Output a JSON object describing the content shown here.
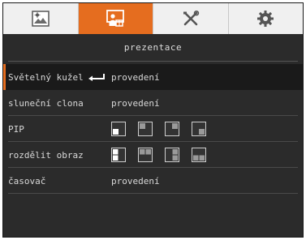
{
  "tabs": [
    {
      "name": "picture",
      "icon": "image-icon",
      "active": false
    },
    {
      "name": "presentation",
      "icon": "presenter-icon",
      "active": true
    },
    {
      "name": "tools",
      "icon": "tools-icon",
      "active": false
    },
    {
      "name": "settings",
      "icon": "gear-icon",
      "active": false
    }
  ],
  "colors": {
    "accent": "#e56d1f",
    "panel": "#2b2b2b",
    "text": "#d8d8d8"
  },
  "title": "prezentace",
  "rows": [
    {
      "label": "Světelný kužel",
      "value": "provedení",
      "selected": true,
      "icon": "enter-icon"
    },
    {
      "label": "sluneční clona",
      "value": "provedení"
    },
    {
      "label": "PIP",
      "options": [
        "pip-bottom-left-icon",
        "pip-top-left-icon",
        "pip-top-right-icon",
        "pip-bottom-right-icon"
      ]
    },
    {
      "label": "rozdělit obraz",
      "options": [
        "split-left-icon",
        "split-top-icon",
        "split-right-icon",
        "split-bottom-icon"
      ]
    },
    {
      "label": "časovač",
      "value": "provedení"
    }
  ]
}
